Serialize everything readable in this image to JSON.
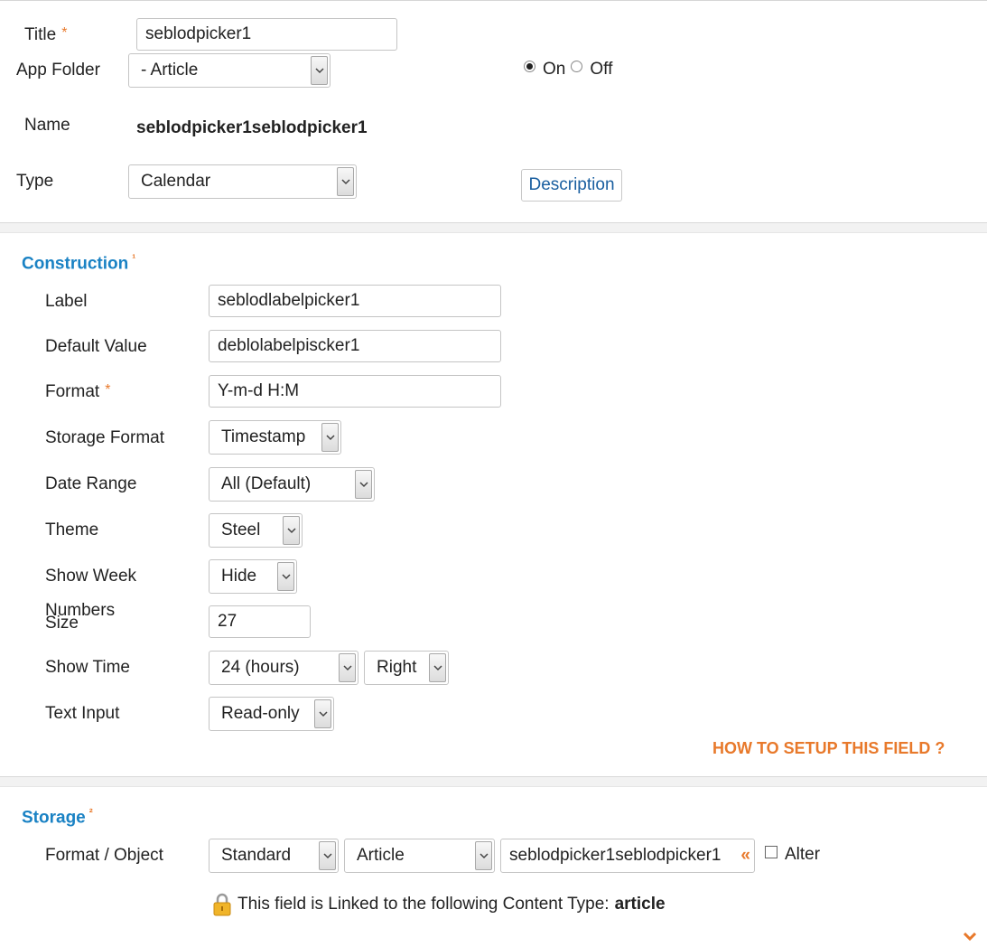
{
  "header": {
    "title_label": "Title",
    "title_required": "*",
    "title_value": "seblodpicker1",
    "app_folder_label": "App Folder",
    "app_folder_value": "- Article",
    "state_on_label": "On",
    "state_off_label": "Off",
    "state_selected": "On",
    "name_label": "Name",
    "name_value": "seblodpicker1seblodpicker1",
    "type_label": "Type",
    "type_value": "Calendar",
    "description_button": "Description"
  },
  "construction": {
    "title": "Construction",
    "marker": "¹",
    "fields": {
      "label_label": "Label",
      "label_value": "seblodlabelpicker1",
      "default_label": "Default Value",
      "default_value": "deblolabelpiscker1",
      "format_label": "Format",
      "format_required": "*",
      "format_value": "Y-m-d H:M",
      "storage_format_label": "Storage Format",
      "storage_format_value": "Timestamp",
      "date_range_label": "Date Range",
      "date_range_value": "All (Default)",
      "theme_label": "Theme",
      "theme_value": "Steel",
      "show_week_label": "Show Week",
      "show_week_label2": "Numbers",
      "show_week_value": "Hide",
      "size_label": "Size",
      "size_value": "27",
      "show_time_label": "Show Time",
      "show_time_value": "24 (hours)",
      "show_time_position": "Right",
      "text_input_label": "Text Input",
      "text_input_value": "Read-only"
    },
    "howto_link": "HOW TO SETUP THIS FIELD ?"
  },
  "storage": {
    "title": "Storage",
    "marker": "²",
    "format_label": "Format / Object",
    "format_value": "Standard",
    "object_value": "Article",
    "field_value": "seblodpicker1seblodpicker1",
    "field_link_glyph": "«",
    "alter_label": "Alter",
    "linked_text": "This field is Linked to the following Content Type:",
    "linked_type": "article"
  },
  "colors": {
    "accent_blue": "#1a82c4",
    "accent_orange": "#e8792b",
    "link_blue": "#1a5fa0"
  },
  "icons": {
    "lock": "lock-icon",
    "expand": "chevron-down-icon"
  }
}
